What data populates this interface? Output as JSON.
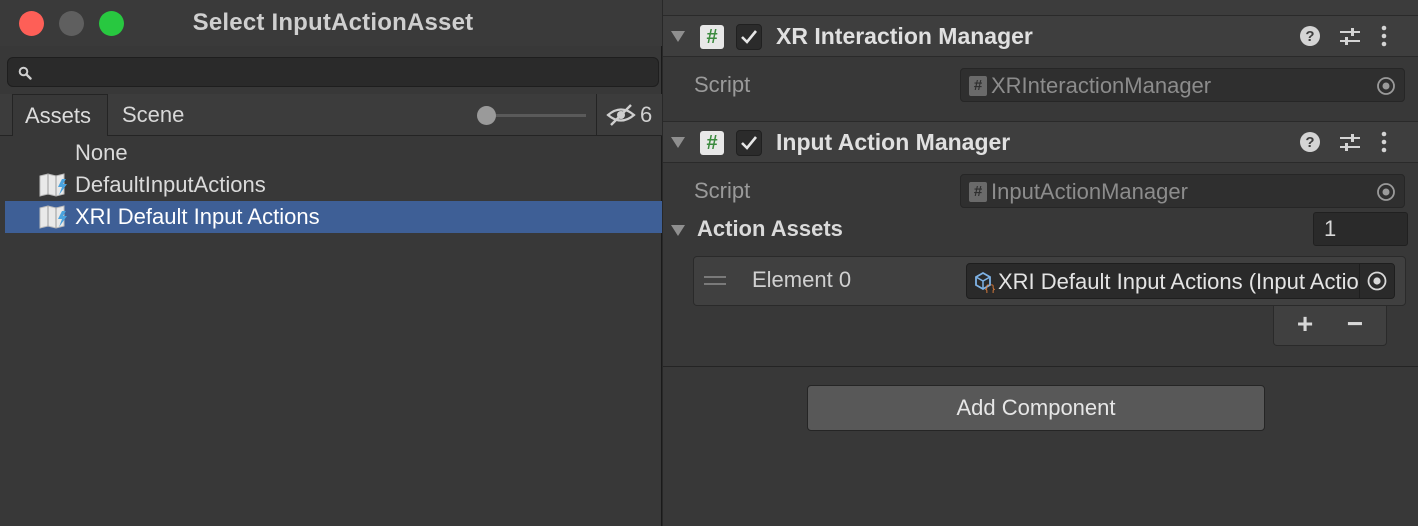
{
  "picker_window": {
    "title": "Select InputActionAsset",
    "search": {
      "value": "",
      "placeholder": ""
    },
    "tabs": {
      "assets": "Assets",
      "scene": "Scene"
    },
    "visibility_count": "6",
    "items": [
      {
        "label": "None",
        "icon": ""
      },
      {
        "label": "DefaultInputActions",
        "icon": "input-actions-asset-icon"
      },
      {
        "label": "XRI Default Input Actions",
        "icon": "input-actions-asset-icon",
        "selected": true
      }
    ]
  },
  "inspector": {
    "components": [
      {
        "title": "XR Interaction Manager",
        "enabled": true,
        "script_label": "Script",
        "script_value": "XRInteractionManager"
      },
      {
        "title": "Input Action Manager",
        "enabled": true,
        "script_label": "Script",
        "script_value": "InputActionManager"
      }
    ],
    "action_assets": {
      "label": "Action Assets",
      "count": "1",
      "elements": [
        {
          "label": "Element 0",
          "value": "XRI Default Input Actions (Input Action Asset)"
        }
      ],
      "add_symbol": "+",
      "remove_symbol": "−"
    },
    "add_component_label": "Add Component"
  },
  "colors": {
    "selection": "#3e5f96",
    "close": "#fe5f57",
    "zoom": "#28c840",
    "script_hash": "#3b8a3e"
  }
}
